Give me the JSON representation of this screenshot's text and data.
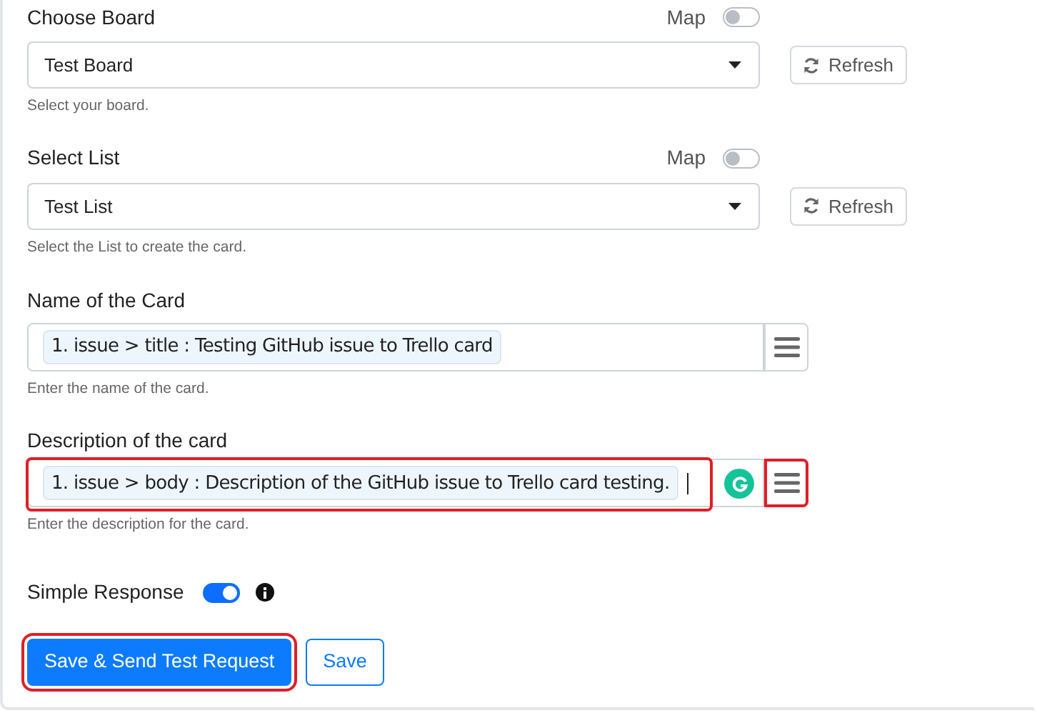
{
  "fields": [
    {
      "kind": "select",
      "label": "Choose Board",
      "map_label": "Map",
      "map_on": false,
      "value": "Test Board",
      "refresh": "Refresh",
      "help": "Select your board."
    },
    {
      "kind": "select",
      "label": "Select List",
      "map_label": "Map",
      "map_on": false,
      "value": "Test List",
      "refresh": "Refresh",
      "help": "Select the List to create the card."
    },
    {
      "kind": "mapped",
      "label": "Name of the Card",
      "token": "1. issue > title : Testing GitHub issue to Trello card",
      "highlighted": false,
      "cursor": false,
      "grammarly": false,
      "help": "Enter the name of the card."
    },
    {
      "kind": "mapped",
      "label": "Description of the card",
      "token": "1. issue > body : Description of the GitHub issue to Trello card testing.",
      "highlighted": true,
      "cursor": true,
      "grammarly": true,
      "help": "Enter the description for the card."
    }
  ],
  "simple_response": {
    "label": "Simple Response",
    "on": true
  },
  "buttons": [
    {
      "kind": "primary",
      "label": "Save & Send Test Request",
      "highlighted": true
    },
    {
      "kind": "outline",
      "label": "Save",
      "highlighted": false
    }
  ]
}
